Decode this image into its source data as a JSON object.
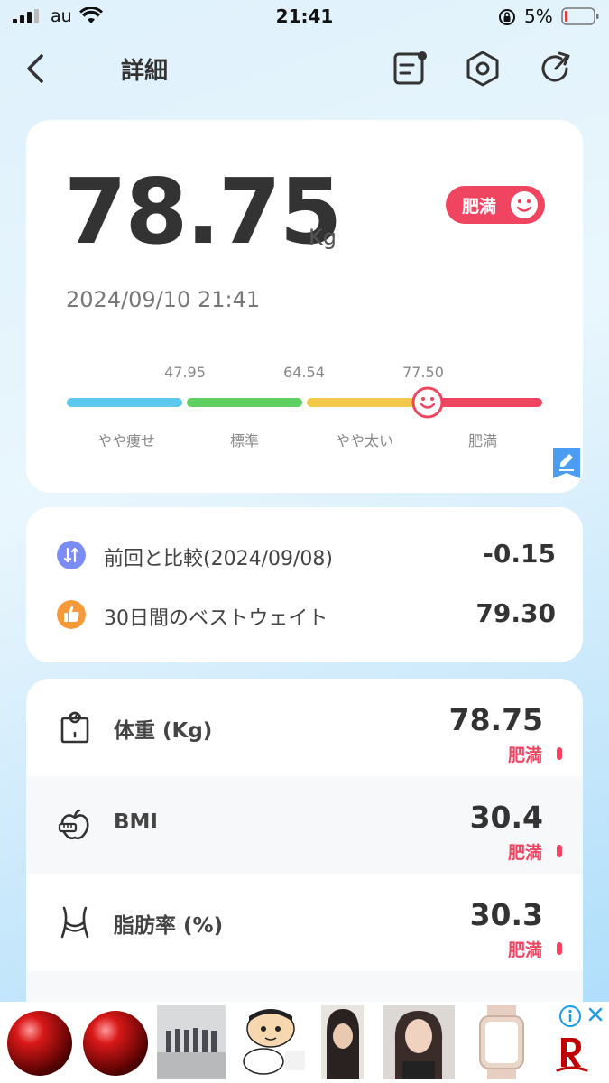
{
  "status_bar": {
    "carrier": "au",
    "time": "21:41",
    "battery": "5%"
  },
  "nav": {
    "title": "詳細",
    "icons": [
      "back-chevron-icon",
      "report-icon",
      "settings-hexagon-icon",
      "share-icon"
    ]
  },
  "summary": {
    "weight": "78.75",
    "unit": "Kg",
    "status": "肥満",
    "measured_at": "2024/09/10 21:41"
  },
  "scale": {
    "thresholds": [
      "47.95",
      "64.54",
      "77.50"
    ],
    "categories": [
      "やや痩せ",
      "標準",
      "やや太い",
      "肥満"
    ],
    "segment_colors": [
      "#5bc8ec",
      "#5fcf62",
      "#f2c94c",
      "#ef4560"
    ]
  },
  "comparison": [
    {
      "label": "前回と比較(2024/09/08)",
      "value": "-0.15",
      "icon": "compare-arrows-icon",
      "color": "#7b8cf5"
    },
    {
      "label": "30日間のベストウェイト",
      "value": "79.30",
      "icon": "thumbs-up-icon",
      "color": "#f5993a"
    }
  ],
  "metrics": [
    {
      "label": "体重 (Kg)",
      "value": "78.75",
      "status": "肥満",
      "icon": "scale-icon"
    },
    {
      "label": "BMI",
      "value": "30.4",
      "status": "肥満",
      "icon": "apple-tape-icon"
    },
    {
      "label": "脂肪率 (%)",
      "value": "30.3",
      "status": "肥満",
      "icon": "waist-icon"
    }
  ],
  "colors": {
    "accent": "#ef4560"
  }
}
